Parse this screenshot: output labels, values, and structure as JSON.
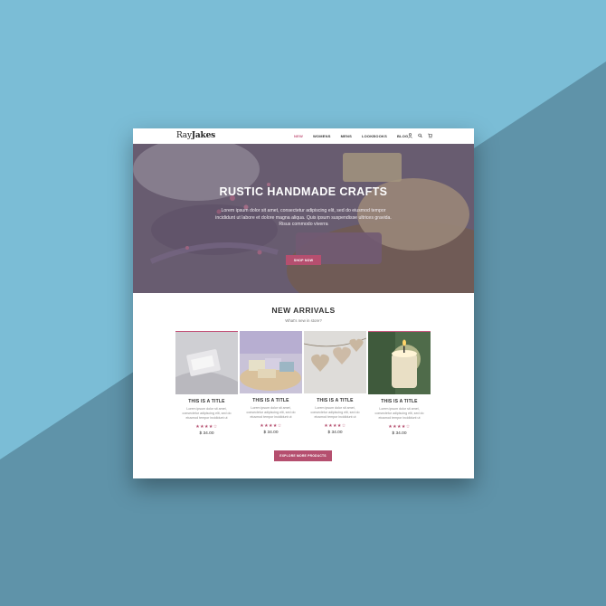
{
  "brand": {
    "logo_part1": "Ray",
    "logo_part2": "Jakes"
  },
  "nav": {
    "items": [
      {
        "label": "NEW",
        "active": true
      },
      {
        "label": "WOMENS",
        "active": false
      },
      {
        "label": "MENS",
        "active": false
      },
      {
        "label": "LOOKBOOKS",
        "active": false
      },
      {
        "label": "BLOG",
        "active": false
      }
    ],
    "icons": [
      "user-icon",
      "search-icon",
      "cart-icon"
    ]
  },
  "hero": {
    "title": "RUSTIC HANDMADE CRAFTS",
    "text": "Lorem ipsum dolor sit amet, consectetur adipiscing elit, sed do eiusmod tempor incididunt ut labore et dolore magna aliqua. Quis ipsum suspendisse ultrices gravida. Risus commodo viverra",
    "button": "SHOP NOW"
  },
  "arrivals": {
    "title": "NEW ARRIVALS",
    "subtitle": "What's new in store?",
    "products": [
      {
        "title": "THIS IS A TITLE",
        "desc": "Lorem ipsum dolor sit amet, consectetur adipiscing elit, sed do eiusmod tempor incididunt ut",
        "stars": "★★★★☆",
        "price": "$ 34.00"
      },
      {
        "title": "THIS IS A TITLE",
        "desc": "Lorem ipsum dolor sit amet, consectetur adipiscing elit, sed do eiusmod tempor incididunt ut",
        "stars": "★★★★☆",
        "price": "$ 34.00"
      },
      {
        "title": "THIS IS A TITLE",
        "desc": "Lorem ipsum dolor sit amet, consectetur adipiscing elit, sed do eiusmod tempor incididunt ut",
        "stars": "★★★★☆",
        "price": "$ 34.00"
      },
      {
        "title": "THIS IS A TITLE",
        "desc": "Lorem ipsum dolor sit amet, consectetur adipiscing elit, sed do eiusmod tempor incididunt ut",
        "stars": "★★★★☆",
        "price": "$ 34.00"
      }
    ],
    "button": "EXPLORE MORE PRODUCTS"
  },
  "colors": {
    "accent": "#b54f6f",
    "background": "#7bbdd6",
    "background_dark": "#5e93a8"
  }
}
